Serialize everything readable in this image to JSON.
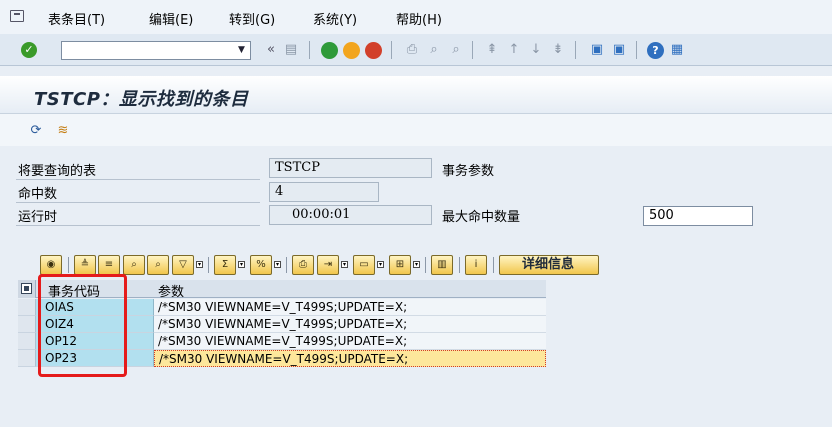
{
  "menu": {
    "items": [
      "表条目(T)",
      "编辑(E)",
      "转到(G)",
      "系统(Y)",
      "帮助(H)"
    ]
  },
  "toolbar": {
    "command_value": "",
    "icons": [
      "ok-icon",
      "save-icon",
      "back-icon",
      "exit-icon",
      "cancel-icon",
      "print-icon",
      "find-icon",
      "find-next-icon",
      "first-page-icon",
      "prev-page-icon",
      "next-page-icon",
      "last-page-icon",
      "new-session-icon",
      "shortcut-icon",
      "help-icon",
      "layout-icon"
    ]
  },
  "title": "TSTCP：显示找到的条目",
  "form": {
    "table_label": "将要查询的表",
    "table_value": "TSTCP",
    "table_desc": "事务参数",
    "hits_label": "命中数",
    "hits_value": "4",
    "runtime_label": "运行时",
    "runtime_value": "00:00:01",
    "max_hits_label": "最大命中数量",
    "max_hits_value": "500"
  },
  "alv": {
    "detail_label": "详细信息"
  },
  "grid": {
    "headers": [
      "事务代码",
      "参数"
    ],
    "rows": [
      {
        "code": "OIAS",
        "param": "/*SM30 VIEWNAME=V_T499S;UPDATE=X;"
      },
      {
        "code": "OIZ4",
        "param": "/*SM30 VIEWNAME=V_T499S;UPDATE=X;"
      },
      {
        "code": "OP12",
        "param": "/*SM30 VIEWNAME=V_T499S;UPDATE=X;"
      },
      {
        "code": "OP23",
        "param": "/*SM30 VIEWNAME=V_T499S;UPDATE=X;"
      }
    ]
  },
  "colors": {
    "highlight_box": "#e51b1b",
    "key_column": "#b2e0ef",
    "focused_cell": "#fde79b"
  }
}
